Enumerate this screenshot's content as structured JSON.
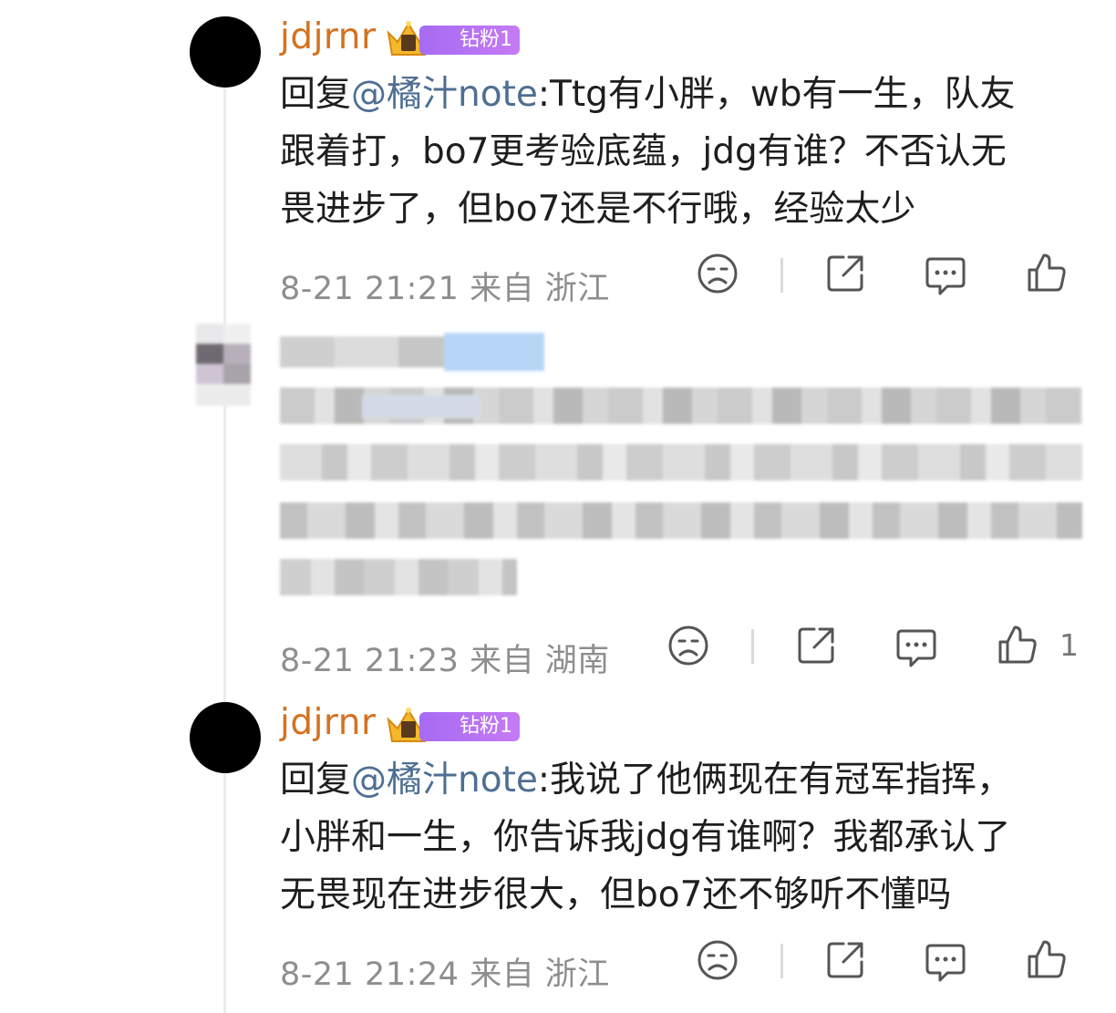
{
  "comments": [
    {
      "username": "jdjrnr",
      "badge": "钻粉1",
      "reply_prefix": "回复",
      "mention": "@橘汁note",
      "line1": ":Ttg有小胖，wb有一生，队友",
      "line2": "跟着打，bo7更考验底蕴，jdg有谁？不否认无",
      "line3": "畏进步了，但bo7还是不行哦，经验太少",
      "time": "8-21 21:21",
      "location": "来自 浙江"
    },
    {
      "hidden": true,
      "time": "8-21 21:23",
      "location": "来自 湖南",
      "likes": "1"
    },
    {
      "username": "jdjrnr",
      "badge": "钻粉1",
      "reply_prefix": "回复",
      "mention": "@橘汁note",
      "line1": ":我说了他俩现在有冠军指挥，",
      "line2": "小胖和一生，你告诉我jdg有谁啊？我都承认了",
      "line3": "无畏现在进步很大，但bo7还不够听不懂吗",
      "time": "8-21 21:24",
      "location": "来自 浙江"
    }
  ],
  "icons": [
    "dislike-icon",
    "share-icon",
    "comment-icon",
    "like-icon"
  ]
}
